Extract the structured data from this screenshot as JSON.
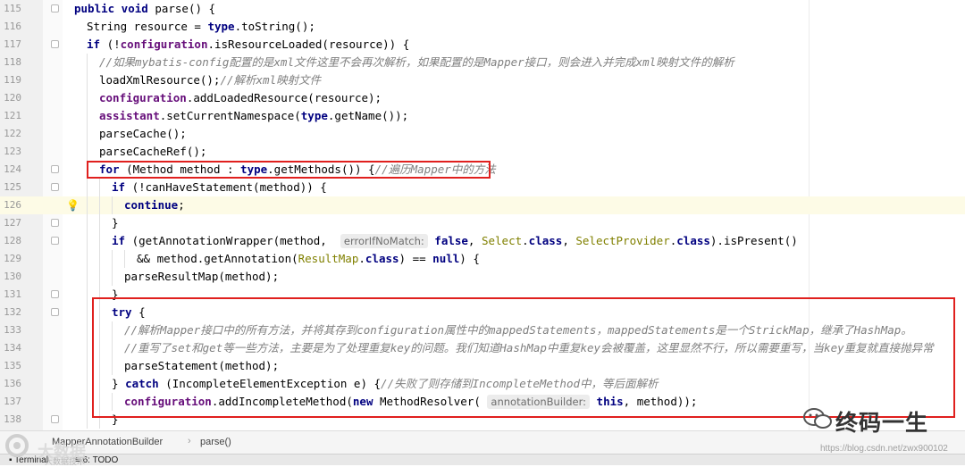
{
  "editor": {
    "lines": [
      {
        "num": "115",
        "indent": 0,
        "segs": [
          [
            "kw",
            "public void "
          ],
          [
            "",
            "parse() {"
          ]
        ]
      },
      {
        "num": "116",
        "indent": 1,
        "segs": [
          [
            "",
            "String resource = "
          ],
          [
            "kw",
            "type"
          ],
          [
            "",
            ".toString();"
          ]
        ]
      },
      {
        "num": "117",
        "indent": 1,
        "segs": [
          [
            "kw",
            "if "
          ],
          [
            "",
            "(!"
          ],
          [
            "fld",
            "configuration"
          ],
          [
            "",
            ".isResourceLoaded(resource)) {"
          ]
        ]
      },
      {
        "num": "118",
        "indent": 2,
        "segs": [
          [
            "cm",
            "//如果mybatis-config配置的是xml文件这里不会再次解析，如果配置的是Mapper接口，则会进入并完成xml映射文件的解析"
          ]
        ]
      },
      {
        "num": "119",
        "indent": 2,
        "segs": [
          [
            "",
            "loadXmlResource();"
          ],
          [
            "cm",
            "//解析xml映射文件"
          ]
        ]
      },
      {
        "num": "120",
        "indent": 2,
        "segs": [
          [
            "fld",
            "configuration"
          ],
          [
            "",
            ".addLoadedResource(resource);"
          ]
        ]
      },
      {
        "num": "121",
        "indent": 2,
        "segs": [
          [
            "fld",
            "assistant"
          ],
          [
            "",
            ".setCurrentNamespace("
          ],
          [
            "kw",
            "type"
          ],
          [
            "",
            ".getName());"
          ]
        ]
      },
      {
        "num": "122",
        "indent": 2,
        "segs": [
          [
            "",
            "parseCache();"
          ]
        ]
      },
      {
        "num": "123",
        "indent": 2,
        "segs": [
          [
            "",
            "parseCacheRef();"
          ]
        ]
      },
      {
        "num": "124",
        "indent": 2,
        "segs": [
          [
            "kw",
            "for "
          ],
          [
            "",
            "(Method method : "
          ],
          [
            "kw",
            "type"
          ],
          [
            "",
            ".getMethods()) {"
          ],
          [
            "cm",
            "//遍历Mapper中的方法"
          ]
        ]
      },
      {
        "num": "125",
        "indent": 3,
        "segs": [
          [
            "kw",
            "if "
          ],
          [
            "",
            "(!canHaveStatement(method)) {"
          ]
        ]
      },
      {
        "num": "126",
        "indent": 4,
        "segs": [
          [
            "kw",
            "continue"
          ],
          [
            "",
            ";"
          ]
        ],
        "caret": true
      },
      {
        "num": "127",
        "indent": 3,
        "segs": [
          [
            "",
            "}"
          ]
        ]
      },
      {
        "num": "128",
        "indent": 3,
        "segs": [
          [
            "kw",
            "if "
          ],
          [
            "",
            "(getAnnotationWrapper(method,  "
          ],
          [
            "hint",
            "errorIfNoMatch:"
          ],
          [
            "kw",
            " false"
          ],
          [
            "",
            ", "
          ],
          [
            "cls",
            "Select"
          ],
          [
            "",
            "."
          ],
          [
            "kw",
            "class"
          ],
          [
            "",
            ", "
          ],
          [
            "cls",
            "SelectProvider"
          ],
          [
            "",
            "."
          ],
          [
            "kw",
            "class"
          ],
          [
            "",
            ").isPresent()"
          ]
        ]
      },
      {
        "num": "129",
        "indent": 5,
        "segs": [
          [
            "",
            "&& method.getAnnotation("
          ],
          [
            "cls",
            "ResultMap"
          ],
          [
            "",
            "."
          ],
          [
            "kw",
            "class"
          ],
          [
            "",
            ") == "
          ],
          [
            "kw",
            "null"
          ],
          [
            "",
            ") {"
          ]
        ]
      },
      {
        "num": "130",
        "indent": 4,
        "segs": [
          [
            "",
            "parseResultMap(method);"
          ]
        ]
      },
      {
        "num": "131",
        "indent": 3,
        "segs": [
          [
            "",
            "}"
          ]
        ]
      },
      {
        "num": "132",
        "indent": 3,
        "segs": [
          [
            "kw",
            "try "
          ],
          [
            "",
            "{"
          ]
        ]
      },
      {
        "num": "133",
        "indent": 4,
        "segs": [
          [
            "cm",
            "//解析Mapper接口中的所有方法，并将其存到configuration属性中的mappedStatements，mappedStatements是一个StrickMap，继承了HashMap。"
          ]
        ]
      },
      {
        "num": "134",
        "indent": 4,
        "segs": [
          [
            "cm",
            "//重写了set和get等一些方法，主要是为了处理重复key的问题。我们知道HashMap中重复key会被覆盖，这里显然不行，所以需要重写，当key重复就直接抛异常"
          ]
        ]
      },
      {
        "num": "135",
        "indent": 4,
        "segs": [
          [
            "",
            "parseStatement(method);"
          ]
        ]
      },
      {
        "num": "136",
        "indent": 3,
        "segs": [
          [
            "",
            "} "
          ],
          [
            "kw",
            "catch "
          ],
          [
            "",
            "(IncompleteElementException e) {"
          ],
          [
            "cm",
            "//失败了则存储到IncompleteMethod中，等后面解析"
          ]
        ]
      },
      {
        "num": "137",
        "indent": 4,
        "segs": [
          [
            "fld",
            "configuration"
          ],
          [
            "",
            ".addIncompleteMethod("
          ],
          [
            "kw",
            "new "
          ],
          [
            "",
            "MethodResolver( "
          ],
          [
            "hint",
            "annotationBuilder:"
          ],
          [
            "kw",
            " this"
          ],
          [
            "",
            ", method));"
          ]
        ]
      },
      {
        "num": "138",
        "indent": 3,
        "segs": [
          [
            "",
            "}"
          ]
        ]
      }
    ]
  },
  "breadcrumb": {
    "class_name": "MapperAnnotationBuilder",
    "separator": "›",
    "method_name": "parse()"
  },
  "toolbar": {
    "terminal_label": "Terminal",
    "todo_label": "6: TODO"
  },
  "watermark": {
    "logo_text": "大数据",
    "sub_text": "大数据技术",
    "author": "终码一生",
    "url": "https://blog.csdn.net/zwx900102"
  },
  "colors": {
    "keyword": "#000080",
    "field": "#660e7a",
    "comment": "#808080",
    "annotation_class": "#808000",
    "highlight_border": "#e0201e"
  }
}
